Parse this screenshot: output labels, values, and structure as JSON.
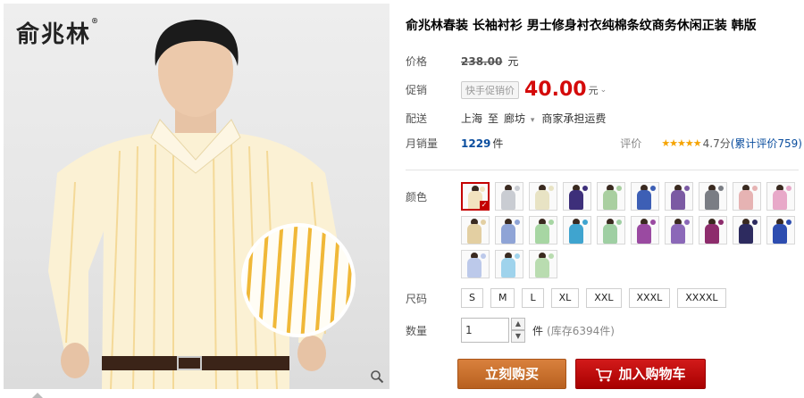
{
  "brand": {
    "name": "俞兆林",
    "mark": "®"
  },
  "product": {
    "title": "俞兆林春装 长袖衬衫 男士修身衬衣纯棉条纹商务休闲正装 韩版"
  },
  "price": {
    "label": "价格",
    "original": "238.00",
    "currency_unit": "元"
  },
  "promo": {
    "label": "促销",
    "tag": "快手促销价",
    "price": "40.00",
    "unit": "元"
  },
  "shipping": {
    "label": "配送",
    "from": "上海",
    "to_word": "至",
    "to": "廊坊",
    "note": "商家承担运费"
  },
  "sales": {
    "label": "月销量",
    "count": "1229",
    "unit": "件",
    "rating_label": "评价",
    "stars": "★★★★★",
    "score": "4.7分",
    "reviews": "(累计评价759)"
  },
  "color": {
    "label": "颜色"
  },
  "swatch_colors": [
    "#f2e3bf",
    "#c9ccd2",
    "#e8e3c4",
    "#3d2f7a",
    "#a9cfa0",
    "#3d5fb5",
    "#7b5aa3",
    "#7a7d84",
    "#e6b3b3",
    "#e8a9c9",
    "#e3cfa2",
    "#8fa4d6",
    "#a7d6a3",
    "#3fa4cf",
    "#9fcfa3",
    "#9a4aa1",
    "#8b68b8",
    "#8d2c6c",
    "#2d2b5f",
    "#2d4db0",
    "#bcc9ea",
    "#9fd3ec",
    "#b9dcb0"
  ],
  "size": {
    "label": "尺码",
    "options": [
      "S",
      "M",
      "L",
      "XL",
      "XXL",
      "XXXL",
      "XXXXL"
    ]
  },
  "quantity": {
    "label": "数量",
    "value": "1",
    "unit": "件",
    "stock": "(库存6394件)"
  },
  "actions": {
    "buy": "立刻购买",
    "cart": "加入购物车"
  },
  "icons": {
    "zoom": "magnifier-icon",
    "cart": "cart-icon",
    "caret": "chevron-down-icon"
  },
  "colors": {
    "price_red": "#d40a0a",
    "buy_orange": "#c87030",
    "cart_red": "#c40000",
    "link_blue": "#0a4d9e"
  }
}
